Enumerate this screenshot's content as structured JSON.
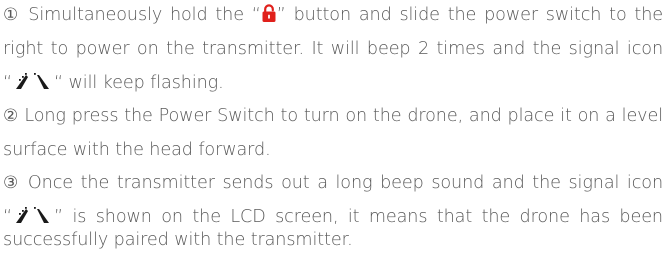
{
  "steps": [
    {
      "number": "①",
      "lines": [
        {
          "before": " Simultaneously hold the “",
          "after": "” button and slide the power switch to the"
        },
        {
          "text": "right to power on the transmitter. It will beep 2 times and the signal icon"
        },
        {
          "before": "“",
          "after": "“ will keep flashing."
        }
      ]
    },
    {
      "number": "②",
      "lines": [
        {
          "text": " Long press the Power Switch to turn on the drone, and place it on a level"
        },
        {
          "text": "surface with the head forward."
        }
      ]
    },
    {
      "number": "③",
      "lines": [
        {
          "text": " Once the transmitter sends out a long beep sound and the signal icon"
        },
        {
          "before": "“",
          "after": "” is shown on the LCD screen, it means that the drone has been"
        },
        {
          "text": "successfully paired with the transmitter."
        }
      ]
    }
  ],
  "icons": {
    "lock": "lock-icon",
    "signal": "signal-icon",
    "lock_color": "#e0201b",
    "signal_color": "#1a1a1a"
  }
}
